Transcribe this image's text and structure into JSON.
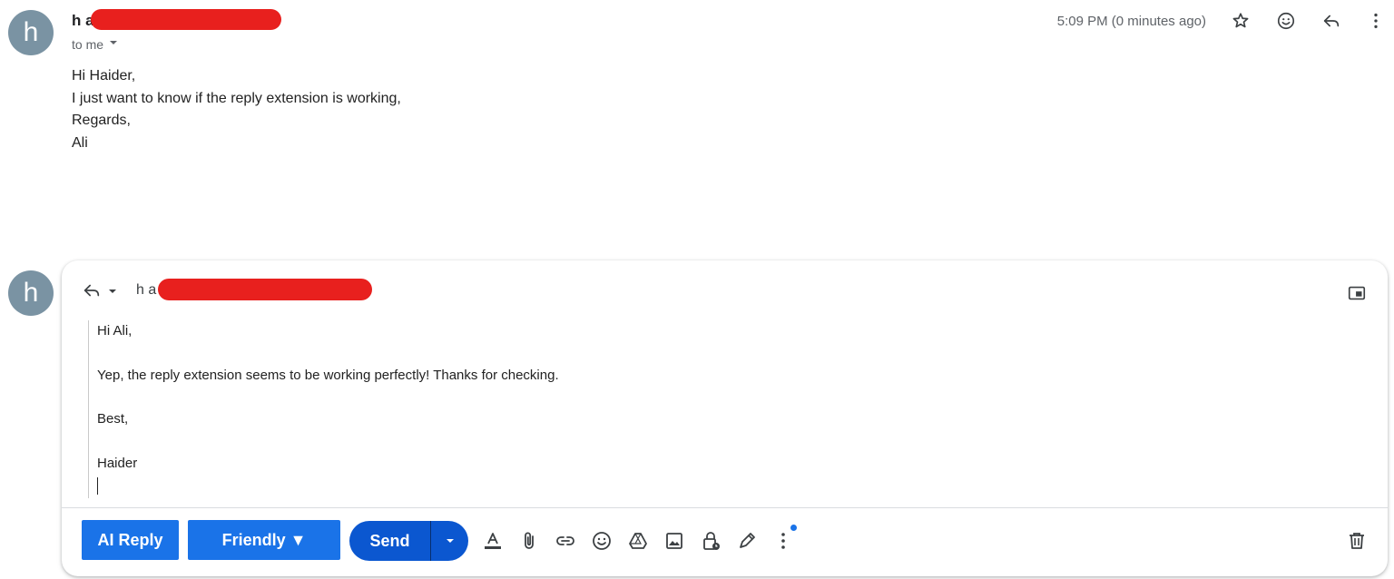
{
  "message": {
    "avatar_letter": "h",
    "sender_visible": "h a",
    "to_label": "to me",
    "timestamp": "5:09 PM (0 minutes ago)",
    "body_lines": [
      "Hi Haider,",
      "I just want to know if the reply extension is working,",
      "Regards,",
      "Ali"
    ],
    "header_icons": [
      "star-icon",
      "emoji-react-icon",
      "reply-icon",
      "more-vert-icon"
    ]
  },
  "reply": {
    "avatar_letter": "h",
    "recipient_visible": "h a",
    "editor_lines": [
      "Hi Ali,",
      "",
      "Yep, the reply extension seems to be working perfectly! Thanks for checking.",
      "",
      "Best,",
      "",
      "Haider"
    ]
  },
  "toolbar": {
    "ai_reply_label": "AI Reply",
    "tone_label": "Friendly ▼",
    "send_label": "Send",
    "tools": [
      "text-format-icon",
      "attach-icon",
      "link-icon",
      "emoji-icon",
      "drive-icon",
      "photo-icon",
      "confidential-lock-icon",
      "signature-pen-icon",
      "more-options-icon"
    ],
    "delete_icon": "trash-icon"
  },
  "colors": {
    "accent": "#1a73e8",
    "send": "#0b57d0",
    "avatar": "#7a93a3",
    "redaction": "#e8201e"
  }
}
